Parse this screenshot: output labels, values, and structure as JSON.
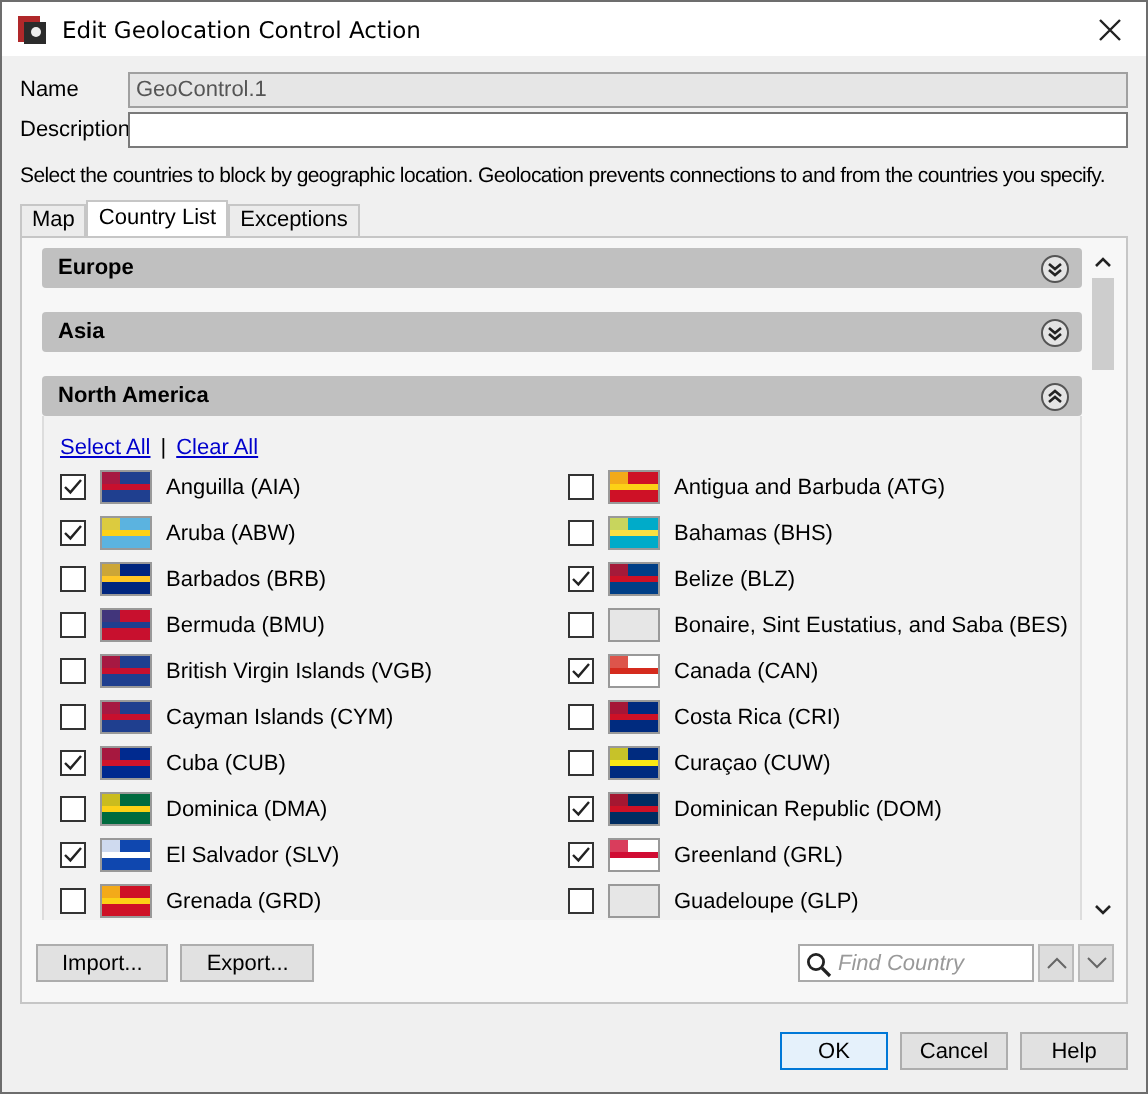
{
  "window": {
    "title": "Edit Geolocation Control Action"
  },
  "fields": [
    {
      "label": "Name",
      "value": "GeoControl.1",
      "disabled": true
    },
    {
      "label": "Description",
      "disabled": false
    }
  ],
  "instructions": "Select the countries to block by geographic location. Geolocation prevents connections to and from the countries you specify.",
  "tabs": [
    {
      "label": "Map",
      "selected": false
    },
    {
      "label": "Country List",
      "selected": true
    },
    {
      "label": "Exceptions",
      "selected": false
    }
  ],
  "sections": [
    {
      "title": "Europe",
      "expanded": false
    },
    {
      "title": "Asia",
      "expanded": false
    },
    {
      "title": "North America",
      "expanded": true,
      "links": [
        "Select All",
        "Clear All"
      ],
      "separator": "|",
      "countries": [
        {
          "name": "Anguilla (AIA)",
          "checked": true
        },
        {
          "name": "Antigua and Barbuda (ATG)",
          "checked": false
        },
        {
          "name": "Aruba (ABW)",
          "checked": true
        },
        {
          "name": "Bahamas (BHS)",
          "checked": false
        },
        {
          "name": "Barbados (BRB)",
          "checked": false
        },
        {
          "name": "Belize (BLZ)",
          "checked": true
        },
        {
          "name": "Bermuda (BMU)",
          "checked": false
        },
        {
          "name": "Bonaire, Sint Eustatius, and Saba (BES)",
          "checked": false
        },
        {
          "name": "British Virgin Islands (VGB)",
          "checked": false
        },
        {
          "name": "Canada (CAN)",
          "checked": true
        },
        {
          "name": "Cayman Islands (CYM)",
          "checked": false
        },
        {
          "name": "Costa Rica (CRI)",
          "checked": false
        },
        {
          "name": "Cuba (CUB)",
          "checked": true
        },
        {
          "name": "Curaçao (CUW)",
          "checked": false
        },
        {
          "name": "Dominica (DMA)",
          "checked": false
        },
        {
          "name": "Dominican Republic (DOM)",
          "checked": true
        },
        {
          "name": "El Salvador (SLV)",
          "checked": true
        },
        {
          "name": "Greenland (GRL)",
          "checked": true
        },
        {
          "name": "Grenada (GRD)",
          "checked": false
        },
        {
          "name": "Guadeloupe (GLP)",
          "checked": false
        }
      ]
    }
  ],
  "panel_buttons": [
    "Import...",
    "Export..."
  ],
  "search": {
    "placeholder": "Find Country"
  },
  "dialog_buttons": [
    {
      "label": "OK",
      "default": true
    },
    {
      "label": "Cancel",
      "default": false
    },
    {
      "label": "Help",
      "default": false
    }
  ]
}
